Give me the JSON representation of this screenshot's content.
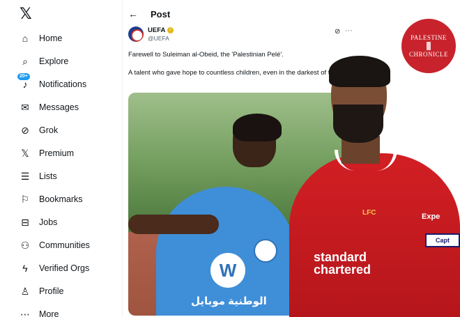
{
  "sidebar": {
    "logo": "𝕏",
    "items": [
      {
        "label": "Home",
        "icon": "home-icon",
        "glyph": "⌂"
      },
      {
        "label": "Explore",
        "icon": "search-icon",
        "glyph": "⌕"
      },
      {
        "label": "Notifications",
        "icon": "bell-icon",
        "glyph": "♪",
        "badge": "20+"
      },
      {
        "label": "Messages",
        "icon": "envelope-icon",
        "glyph": "✉"
      },
      {
        "label": "Grok",
        "icon": "grok-icon",
        "glyph": "⊘"
      },
      {
        "label": "Premium",
        "icon": "x-premium-icon",
        "glyph": "𝕏"
      },
      {
        "label": "Lists",
        "icon": "list-icon",
        "glyph": "☰"
      },
      {
        "label": "Bookmarks",
        "icon": "bookmark-icon",
        "glyph": "⚐"
      },
      {
        "label": "Jobs",
        "icon": "briefcase-icon",
        "glyph": "⊟"
      },
      {
        "label": "Communities",
        "icon": "people-icon",
        "glyph": "⚇"
      },
      {
        "label": "Verified Orgs",
        "icon": "lightning-icon",
        "glyph": "ϟ"
      },
      {
        "label": "Profile",
        "icon": "person-icon",
        "glyph": "♙"
      },
      {
        "label": "More",
        "icon": "more-icon",
        "glyph": "⋯"
      }
    ]
  },
  "header": {
    "back_glyph": "←",
    "title": "Post"
  },
  "tweet": {
    "author_name": "UEFA",
    "author_handle": "@UEFA",
    "grok_glyph": "⊘",
    "more_glyph": "···",
    "text_line1": "Farewell to Suleiman al-Obeid, the 'Palestinian Pelé'.",
    "text_line2": "A talent who gave hope to countless children, even in the darkest of times."
  },
  "photo": {
    "arabic_text": "الوطنية موبايل",
    "logo_glyph": "W"
  },
  "overlay": {
    "sponsor_line1": "standard",
    "sponsor_line2": "chartered",
    "club_badge": "LFC",
    "sleeve_text": "Expe",
    "armband": "Capt"
  },
  "watermark": {
    "line1": "PALESTINE",
    "line2": "CHRONICLE"
  },
  "colors": {
    "accent": "#1d9bf0",
    "uefa_verified": "#e2b719",
    "chronicle_red": "#c8232c"
  }
}
